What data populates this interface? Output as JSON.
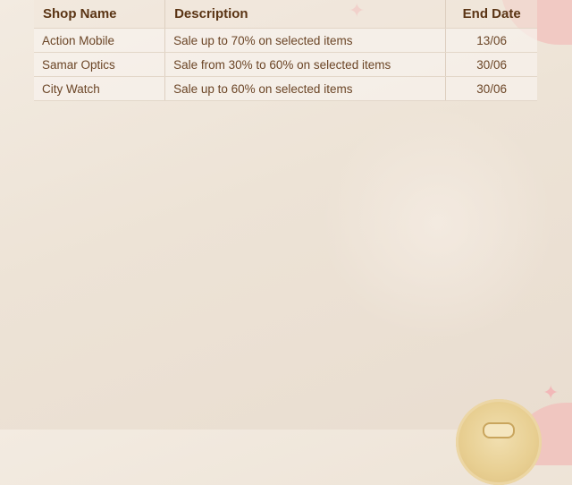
{
  "table": {
    "headers": {
      "shop_name": "Shop Name",
      "description": "Description",
      "end_date": "End Date"
    },
    "rows": [
      {
        "shop": "Action Mobile",
        "description": "Sale up to 70% on selected items",
        "end_date": "13/06"
      },
      {
        "shop": "Samar Optics",
        "description": "Sale from 30% to 60% on selected items",
        "end_date": "30/06"
      },
      {
        "shop": "City Watch",
        "description": "Sale up to 60% on selected items",
        "end_date": "30/06"
      }
    ]
  },
  "decor": {
    "sparkle_icon": "four-point-sparkle",
    "cookie_icon": "cookie-illustration",
    "accent_color": "#f2b8b8",
    "header_text_color": "#5a3414",
    "body_text_color": "#6b4526",
    "background_color": "#ede3d6"
  }
}
